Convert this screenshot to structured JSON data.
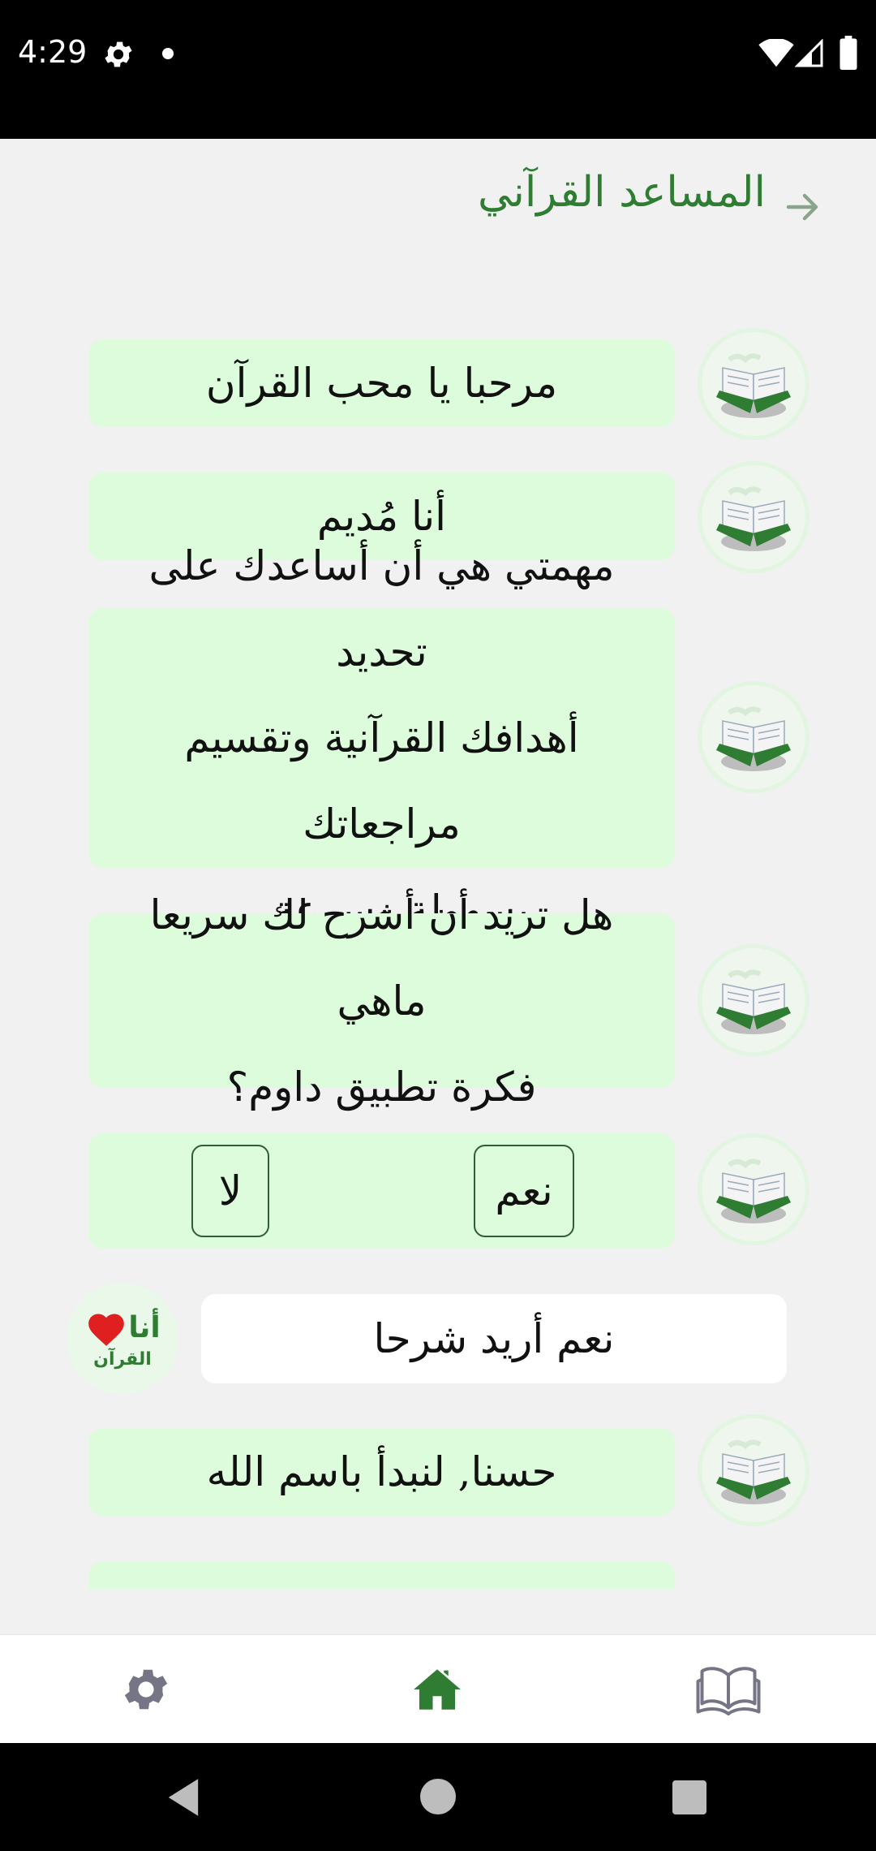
{
  "status_bar": {
    "time": "4:29",
    "icons": [
      "gear-icon",
      "dot-icon",
      "wifi-icon",
      "signal-icon",
      "battery-icon"
    ]
  },
  "header": {
    "title": "المساعد القرآني",
    "back_icon": "arrow-right-icon"
  },
  "chat": {
    "messages": [
      {
        "sender": "bot",
        "text": "مرحبا يا محب القرآن"
      },
      {
        "sender": "bot",
        "text": "أنا مُديم"
      },
      {
        "sender": "bot",
        "lines": [
          "مهمتي هي أن أساعدك على تحديد",
          "أهدافك القرآنية وتقسيم مراجعاتك",
          "بسهولة وسرعة..."
        ]
      },
      {
        "sender": "bot",
        "lines": [
          "هل تريد أن أشرح لك سريعا ماهي",
          "فكرة تطبيق داوم؟"
        ]
      },
      {
        "sender": "bot",
        "choices": {
          "yes": "نعم",
          "no": "لا"
        }
      },
      {
        "sender": "user",
        "text": "نعم أريد شرحا",
        "avatar": {
          "line1": "أنا",
          "line2": "القرآن"
        }
      },
      {
        "sender": "bot",
        "text": "حسنا, لنبدأ باسم الله"
      }
    ]
  },
  "bottom_nav": {
    "items": [
      {
        "icon": "gear-icon",
        "active": false
      },
      {
        "icon": "home-icon",
        "active": true
      },
      {
        "icon": "open-book-icon",
        "active": false
      }
    ]
  },
  "colors": {
    "accent": "#2e7d32",
    "bot_bubble": "#dcfcdc",
    "user_bubble": "#ffffff",
    "background": "#f1f1f1",
    "nav_inactive": "#757585"
  }
}
